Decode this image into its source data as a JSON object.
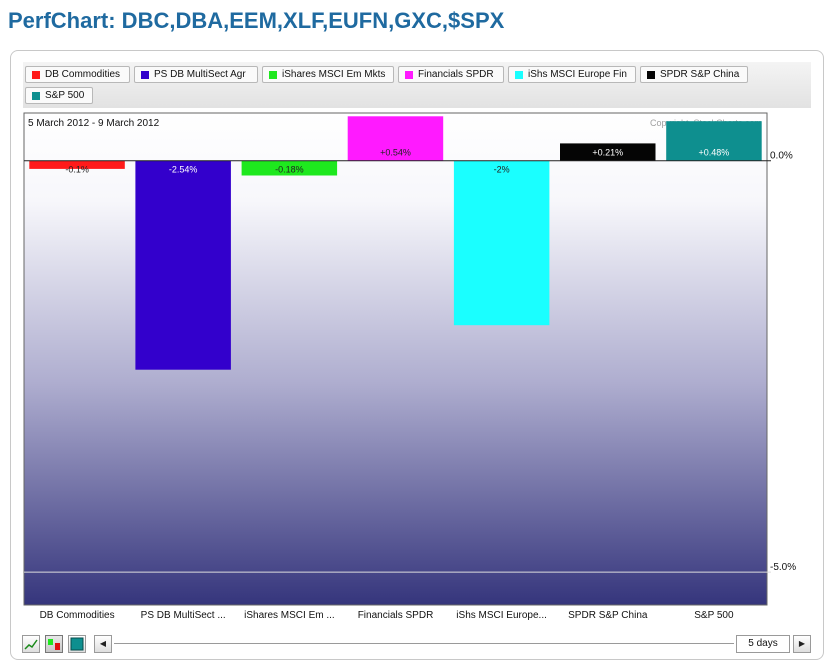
{
  "page": {
    "title": "PerfChart: DBC,DBA,EEM,XLF,EUFN,GXC,$SPX"
  },
  "legend": [
    {
      "label": "DB Commodities",
      "color": "#ff1a1a"
    },
    {
      "label": "PS DB MultiSect  Agr",
      "color": "#3300cc"
    },
    {
      "label": "iShares MSCI Em Mkts",
      "color": "#1ee81e"
    },
    {
      "label": "Financials SPDR",
      "color": "#ff1aff"
    },
    {
      "label": "iShs MSCI Europe Fin",
      "color": "#1affff"
    },
    {
      "label": "SPDR S&P China",
      "color": "#050505"
    },
    {
      "label": "S&P 500",
      "color": "#0e8f8f"
    }
  ],
  "chart_data": {
    "type": "bar",
    "date_range": "5 March 2012 - 9 March 2012",
    "copyright": "Copyright, StockCharts.com",
    "categories": [
      "DB Commodities",
      "PS DB MultiSect ...",
      "iShares MSCI Em ...",
      "Financials SPDR",
      "iShs MSCI Europe...",
      "SPDR S&P China",
      "S&P 500"
    ],
    "values": [
      -0.1,
      -2.54,
      -0.18,
      0.54,
      -2.0,
      0.21,
      0.48
    ],
    "data_labels": [
      "-0.1%",
      "-2.54%",
      "-0.18%",
      "+0.54%",
      "-2%",
      "+0.21%",
      "+0.48%"
    ],
    "colors": [
      "#ff1a1a",
      "#3300cc",
      "#1ee81e",
      "#ff1aff",
      "#1affff",
      "#050505",
      "#0e8f8f"
    ],
    "label_colors": [
      "#222222",
      "#ffffff",
      "#222222",
      "#222222",
      "#222222",
      "#ffffff",
      "#ffffff"
    ],
    "y_ticks": [
      0,
      -5
    ],
    "y_tick_labels": [
      "0.0%",
      "-5.0%"
    ],
    "ylim": [
      -5.4,
      0.58
    ],
    "grid": false,
    "legend_position": "top"
  },
  "toolbar": {
    "period_label": "5 days",
    "buttons": [
      "line-chart-icon",
      "bar-chart-icon",
      "histogram-icon"
    ]
  }
}
